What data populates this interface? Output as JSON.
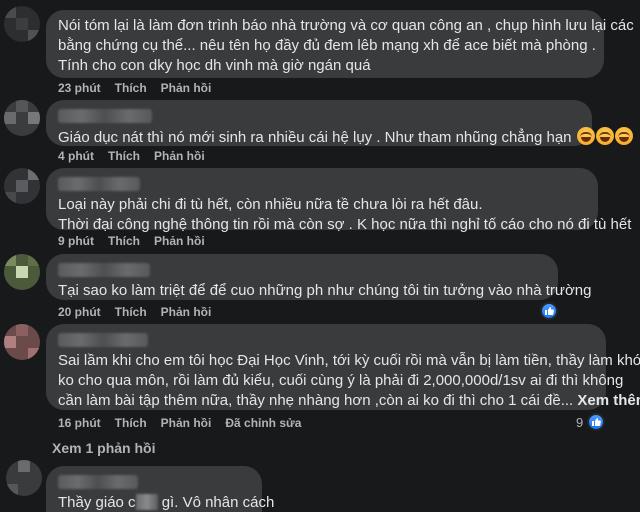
{
  "actions": {
    "like": "Thích",
    "reply": "Phản hồi",
    "edited": "Đã chỉnh sửa"
  },
  "comments": [
    {
      "lines": [
        "Nói tóm lại là làm đơn trình báo nhà trường và cơ quan công an , chụp hình lưu lại các",
        "bằng chứng cụ thể... nêu tên họ đầy đủ đem lêb mạng xh để ace biết mà phòng .",
        "Tính cho con dky học dh vinh mà giờ ngán quá"
      ],
      "time": "23 phút"
    },
    {
      "lines": [
        "Giáo dục nát thì nó mới sinh ra nhiều cái hệ lụy . Như tham nhũng chẳng hạn"
      ],
      "time": "4 phút",
      "emoji_icon": "laughing-emoji-icon"
    },
    {
      "lines": [
        "Loại này phải chi đi tù hết, còn nhiều nữa tề chưa lòi ra hết đâu.",
        "Thời đại công nghệ thông tin rồi mà còn sợ . K học nữa thì nghỉ tố cáo cho nó đi tù hết"
      ],
      "time": "9 phút"
    },
    {
      "lines": [
        "Tại sao ko làm triệt để để cuo những ph như chúng tôi tin tưởng vào nhà trường"
      ],
      "time": "20 phút",
      "reaction_icon": "like-icon"
    },
    {
      "lines": [
        "Sai lầm khi cho em tôi học Đại Học Vinh, tới kỳ cuối rồi mà vẫn bị làm tiền, thầy làm khó",
        "ko cho qua môn, rồi làm đủ kiểu, cuối cùng ý là phải đi 2,000,000d/1sv ai đi thì không",
        "cần làm bài tập thêm nữa, thầy nhẹ nhàng hơn ,còn ai ko đi thì cho 1 cái đề..."
      ],
      "see_more": "Xem thêm",
      "time": "16 phút",
      "reaction_count": "9",
      "reaction_icon": "like-icon",
      "view_replies": "Xem 1 phản hồi"
    },
    {
      "text_before": "Thầy giáo c",
      "text_after": "gì. Vô nhân cách"
    }
  ],
  "colors": {
    "background": "#18191a",
    "bubble": "#3a3b3c",
    "text": "#e4e6eb",
    "meta": "#b0b3b8",
    "like_blue": "#1877f2"
  }
}
